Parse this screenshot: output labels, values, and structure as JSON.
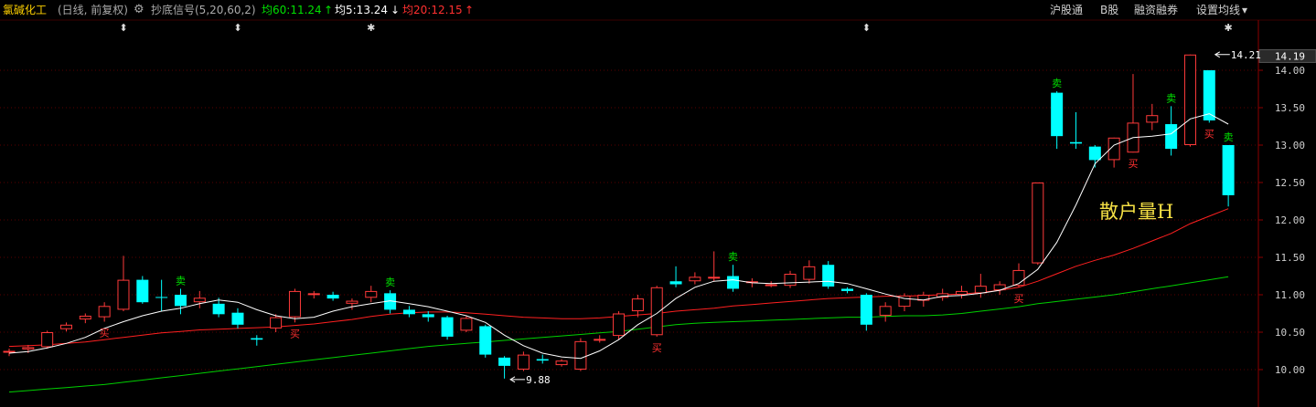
{
  "header": {
    "stock_name": "氯碱化工",
    "period": "(日线, 前复权)",
    "indicator": "抄底信号(5,20,60,2)",
    "ma60_label": "均60:11.24",
    "ma5_label": "均5:13.24",
    "ma20_label": "均20:12.15",
    "ma60_arrow": "↑",
    "ma5_arrow": "↓",
    "ma20_arrow": "↑",
    "links": [
      "沪股通",
      "B股",
      "融资融券",
      "设置均线"
    ],
    "dropdown_icon": "▾"
  },
  "watermark": "散户量H",
  "colors": {
    "up_candle": "#ff3a3a",
    "down_candle": "#00ffff",
    "ma5": "#ffffff",
    "ma20": "#ff2020",
    "ma60": "#00d000",
    "buy_signal": "#ff3030",
    "sell_signal": "#00e000",
    "axis_text": "#cfcfcf"
  },
  "chart_data": {
    "type": "candlestick",
    "y_ticks": [
      "14.00",
      "13.50",
      "13.00",
      "12.50",
      "12.00",
      "11.50",
      "11.00",
      "10.50",
      "10.00"
    ],
    "y_tick_values": [
      14.0,
      13.5,
      13.0,
      12.5,
      12.0,
      11.5,
      11.0,
      10.5,
      10.0
    ],
    "ylim": [
      9.6,
      14.45
    ],
    "current_price_label": "14.19",
    "current_price": 14.19,
    "high_annotation": {
      "label": "14.21",
      "value": 14.21,
      "index": 63
    },
    "low_annotation": {
      "label": "9.88",
      "value": 9.88,
      "index": 26
    },
    "candles": [
      [
        10.24,
        10.25,
        10.18,
        10.28
      ],
      [
        10.27,
        10.3,
        10.22,
        10.33
      ],
      [
        10.3,
        10.5,
        10.28,
        10.52
      ],
      [
        10.54,
        10.6,
        10.51,
        10.63
      ],
      [
        10.67,
        10.72,
        10.62,
        10.75
      ],
      [
        10.7,
        10.85,
        10.64,
        10.9
      ],
      [
        10.8,
        11.2,
        10.78,
        11.52
      ],
      [
        11.2,
        10.9,
        10.88,
        11.25
      ],
      [
        10.97,
        10.96,
        10.78,
        11.2
      ],
      [
        11.0,
        10.85,
        10.74,
        11.08
      ],
      [
        10.9,
        10.96,
        10.82,
        11.05
      ],
      [
        10.88,
        10.74,
        10.7,
        10.96
      ],
      [
        10.76,
        10.6,
        10.55,
        10.82
      ],
      [
        10.42,
        10.4,
        10.32,
        10.46
      ],
      [
        10.55,
        10.7,
        10.5,
        10.74
      ],
      [
        10.7,
        11.05,
        10.63,
        11.08
      ],
      [
        11.0,
        11.02,
        10.95,
        11.05
      ],
      [
        11.0,
        10.95,
        10.92,
        11.04
      ],
      [
        10.88,
        10.92,
        10.8,
        10.95
      ],
      [
        10.96,
        11.05,
        10.9,
        11.12
      ],
      [
        11.02,
        10.8,
        10.75,
        11.06
      ],
      [
        10.8,
        10.74,
        10.7,
        10.85
      ],
      [
        10.74,
        10.7,
        10.64,
        10.78
      ],
      [
        10.7,
        10.44,
        10.4,
        10.72
      ],
      [
        10.52,
        10.69,
        10.5,
        10.72
      ],
      [
        10.58,
        10.2,
        10.16,
        10.6
      ],
      [
        10.16,
        10.05,
        9.88,
        10.18
      ],
      [
        10.0,
        10.2,
        9.98,
        10.24
      ],
      [
        10.14,
        10.12,
        10.08,
        10.2
      ],
      [
        10.06,
        10.12,
        10.04,
        10.14
      ],
      [
        10.0,
        10.38,
        9.98,
        10.42
      ],
      [
        10.4,
        10.41,
        10.36,
        10.46
      ],
      [
        10.45,
        10.75,
        10.4,
        10.78
      ],
      [
        10.78,
        10.95,
        10.7,
        11.0
      ],
      [
        10.46,
        11.1,
        10.44,
        11.12
      ],
      [
        11.18,
        11.14,
        11.1,
        11.38
      ],
      [
        11.18,
        11.24,
        11.14,
        11.3
      ],
      [
        11.22,
        11.24,
        11.18,
        11.58
      ],
      [
        11.25,
        11.08,
        11.04,
        11.4
      ],
      [
        11.17,
        11.18,
        11.1,
        11.22
      ],
      [
        11.14,
        11.14,
        11.1,
        11.18
      ],
      [
        11.12,
        11.28,
        11.09,
        11.32
      ],
      [
        11.2,
        11.38,
        11.15,
        11.46
      ],
      [
        11.4,
        11.11,
        11.08,
        11.45
      ],
      [
        11.08,
        11.05,
        11.02,
        11.1
      ],
      [
        11.0,
        10.6,
        10.52,
        11.02
      ],
      [
        10.72,
        10.85,
        10.64,
        10.9
      ],
      [
        10.84,
        10.99,
        10.78,
        11.02
      ],
      [
        10.92,
        11.0,
        10.84,
        11.04
      ],
      [
        10.96,
        11.02,
        10.92,
        11.08
      ],
      [
        11.0,
        11.05,
        10.95,
        11.12
      ],
      [
        11.02,
        11.12,
        10.96,
        11.28
      ],
      [
        11.06,
        11.14,
        11.0,
        11.18
      ],
      [
        11.12,
        11.33,
        11.1,
        11.42
      ],
      [
        11.42,
        12.5,
        11.4,
        12.5
      ],
      [
        13.7,
        13.12,
        12.95,
        13.72
      ],
      [
        13.04,
        13.02,
        12.95,
        13.44
      ],
      [
        12.98,
        12.8,
        12.7,
        13.0
      ],
      [
        12.8,
        13.1,
        12.7,
        13.1
      ],
      [
        12.9,
        13.3,
        12.9,
        13.95
      ],
      [
        13.3,
        13.4,
        13.2,
        13.55
      ],
      [
        13.28,
        12.95,
        12.86,
        13.52
      ],
      [
        13.0,
        14.21,
        12.98,
        14.21
      ],
      [
        14.0,
        13.33,
        13.3,
        14.0
      ],
      [
        13.0,
        12.33,
        12.18,
        13.0
      ]
    ],
    "ma5": [
      10.22,
      10.24,
      10.29,
      10.35,
      10.43,
      10.55,
      10.64,
      10.72,
      10.78,
      10.82,
      10.88,
      10.93,
      10.9,
      10.8,
      10.72,
      10.68,
      10.7,
      10.78,
      10.84,
      10.88,
      10.92,
      10.88,
      10.84,
      10.78,
      10.72,
      10.63,
      10.46,
      10.32,
      10.22,
      10.17,
      10.15,
      10.25,
      10.4,
      10.6,
      10.75,
      10.95,
      11.1,
      11.18,
      11.2,
      11.16,
      11.15,
      11.16,
      11.17,
      11.18,
      11.15,
      11.08,
      11.01,
      10.95,
      10.93,
      10.98,
      10.99,
      11.02,
      11.06,
      11.15,
      11.34,
      11.7,
      12.2,
      12.75,
      13.0,
      13.1,
      13.12,
      13.15,
      13.35,
      13.42,
      13.28
    ],
    "ma20": [
      10.31,
      10.32,
      10.33,
      10.35,
      10.37,
      10.4,
      10.43,
      10.46,
      10.49,
      10.51,
      10.53,
      10.54,
      10.55,
      10.56,
      10.57,
      10.59,
      10.61,
      10.64,
      10.67,
      10.71,
      10.74,
      10.76,
      10.77,
      10.77,
      10.76,
      10.74,
      10.72,
      10.7,
      10.69,
      10.68,
      10.68,
      10.69,
      10.71,
      10.73,
      10.75,
      10.78,
      10.8,
      10.82,
      10.85,
      10.87,
      10.89,
      10.91,
      10.93,
      10.95,
      10.96,
      10.97,
      10.98,
      10.98,
      10.99,
      11.0,
      11.01,
      11.03,
      11.06,
      11.1,
      11.18,
      11.28,
      11.38,
      11.46,
      11.53,
      11.62,
      11.72,
      11.82,
      11.95,
      12.05,
      12.15
    ],
    "ma60": [
      9.7,
      9.72,
      9.74,
      9.76,
      9.78,
      9.8,
      9.83,
      9.86,
      9.89,
      9.92,
      9.95,
      9.98,
      10.01,
      10.04,
      10.07,
      10.1,
      10.13,
      10.16,
      10.19,
      10.22,
      10.25,
      10.28,
      10.31,
      10.33,
      10.35,
      10.37,
      10.39,
      10.41,
      10.43,
      10.45,
      10.47,
      10.49,
      10.51,
      10.54,
      10.57,
      10.6,
      10.62,
      10.63,
      10.64,
      10.65,
      10.66,
      10.67,
      10.68,
      10.69,
      10.7,
      10.7,
      10.71,
      10.72,
      10.72,
      10.73,
      10.75,
      10.78,
      10.81,
      10.84,
      10.88,
      10.91,
      10.94,
      10.97,
      11.0,
      11.04,
      11.08,
      11.12,
      11.16,
      11.2,
      11.24
    ],
    "buy_signals": [
      {
        "index": 5,
        "label": "买"
      },
      {
        "index": 15,
        "label": "买"
      },
      {
        "index": 34,
        "label": "买"
      },
      {
        "index": 53,
        "label": "买"
      },
      {
        "index": 59,
        "label": "买"
      },
      {
        "index": 63,
        "label": "买"
      }
    ],
    "sell_signals": [
      {
        "index": 9,
        "label": "卖"
      },
      {
        "index": 20,
        "label": "卖"
      },
      {
        "index": 38,
        "label": "卖"
      },
      {
        "index": 55,
        "label": "卖"
      },
      {
        "index": 61,
        "label": "卖"
      },
      {
        "index": 64,
        "label": "卖"
      }
    ],
    "top_markers": [
      {
        "index": 6,
        "symbol": "⬍"
      },
      {
        "index": 12,
        "symbol": "⬍"
      },
      {
        "index": 19,
        "symbol": "✱"
      },
      {
        "index": 45,
        "symbol": "⬍"
      },
      {
        "index": 64,
        "symbol": "✱"
      }
    ]
  }
}
